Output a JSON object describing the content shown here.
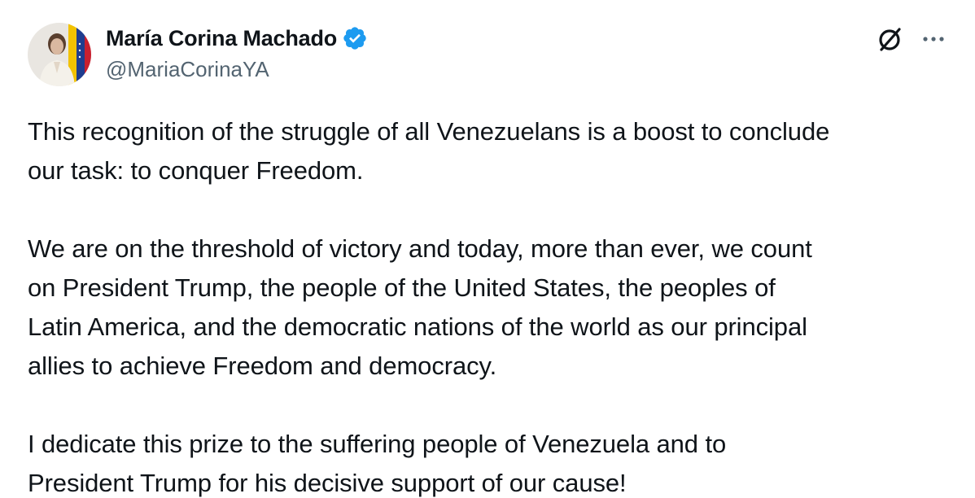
{
  "author": {
    "display_name": "María Corina Machado",
    "handle": "@MariaCorinaYA",
    "verified": true,
    "verified_color": "#1d9bf0"
  },
  "actions": {
    "grok_icon": "grok-icon",
    "more_icon": "more-options-icon"
  },
  "tweet": {
    "paragraphs": [
      "This recognition of the struggle of all Venezuelans is a boost to conclude\nour task: to conquer Freedom.",
      "We are on the threshold of victory and today, more than ever, we count\non President Trump, the people of the United States, the peoples of\nLatin America, and the democratic nations of the world as our principal\nallies to achieve Freedom and democracy.",
      "I dedicate this prize to the suffering people of Venezuela and to\nPresident Trump for his decisive support of our cause!"
    ]
  },
  "colors": {
    "text_primary": "#0f1419",
    "text_secondary": "#536471",
    "background": "#ffffff"
  }
}
